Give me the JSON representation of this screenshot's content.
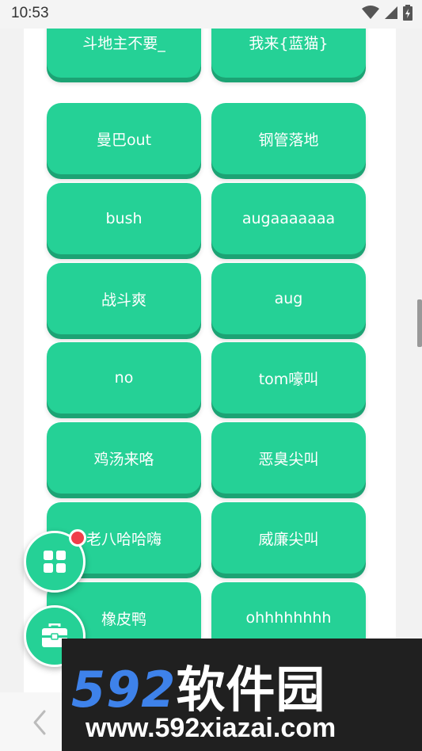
{
  "status_bar": {
    "time": "10:53"
  },
  "sound_buttons": [
    {
      "label": "斗地主不要_"
    },
    {
      "label": "我来{蓝猫}"
    },
    {
      "label": "曼巴out"
    },
    {
      "label": "钢管落地"
    },
    {
      "label": "bush"
    },
    {
      "label": "augaaaaaaa"
    },
    {
      "label": "战斗爽"
    },
    {
      "label": "aug"
    },
    {
      "label": "no"
    },
    {
      "label": "tom嚎叫"
    },
    {
      "label": "鸡汤来咯"
    },
    {
      "label": "恶臭尖叫"
    },
    {
      "label": "老八哈哈嗨"
    },
    {
      "label": "威廉尖叫"
    },
    {
      "label": "橡皮鸭"
    },
    {
      "label": "ohhhhhhhh"
    }
  ],
  "colors": {
    "accent": "#25d196",
    "badge": "#f03e4a",
    "watermark_blue": "#3e82ea"
  },
  "fab": {
    "apps_icon": "grid-apps-icon",
    "toolbox_icon": "toolbox-icon"
  },
  "watermark": {
    "brand_num": "592",
    "brand_cn": "软件园",
    "url": "www.592xiazai.com"
  }
}
